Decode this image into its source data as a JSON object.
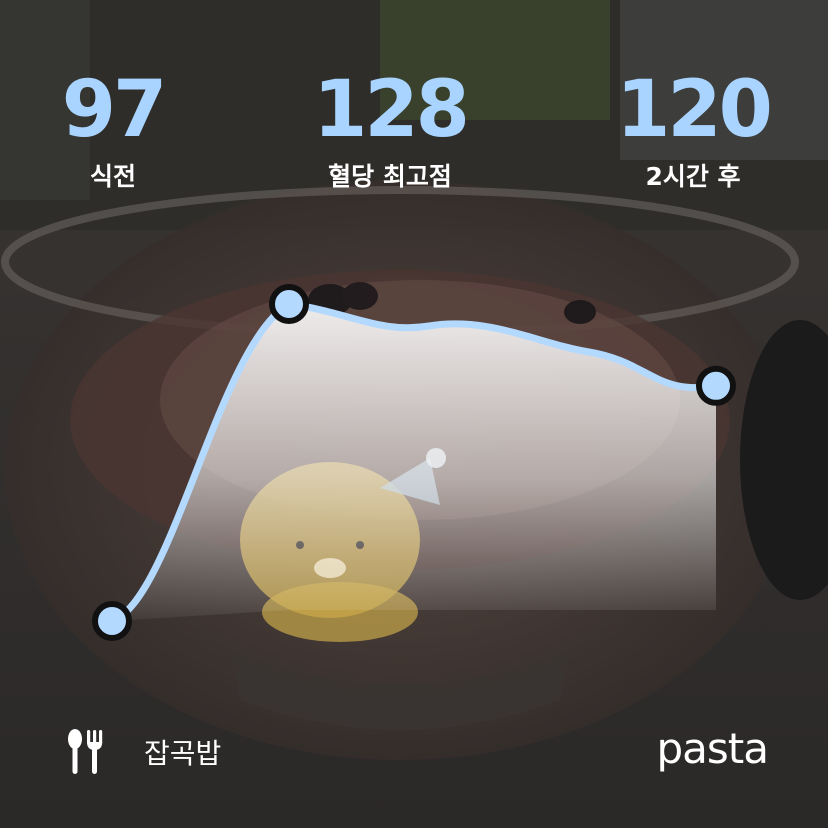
{
  "stats": {
    "before": {
      "value": "97",
      "label": "식전"
    },
    "peak": {
      "value": "128",
      "label": "혈당 최고점"
    },
    "after": {
      "value": "120",
      "label": "2시간 후"
    }
  },
  "meal": {
    "name": "잡곡밥",
    "icon": "fork-knife-icon"
  },
  "brand": "pasta",
  "colors": {
    "accent": "#a9d4ff",
    "line": "#b3d9ff",
    "text": "#ffffff"
  },
  "chart_data": {
    "type": "line",
    "x": [
      "식전",
      "혈당 최고점",
      "2시간 후"
    ],
    "values": [
      97,
      128,
      120
    ],
    "title": "",
    "xlabel": "",
    "ylabel": ""
  }
}
